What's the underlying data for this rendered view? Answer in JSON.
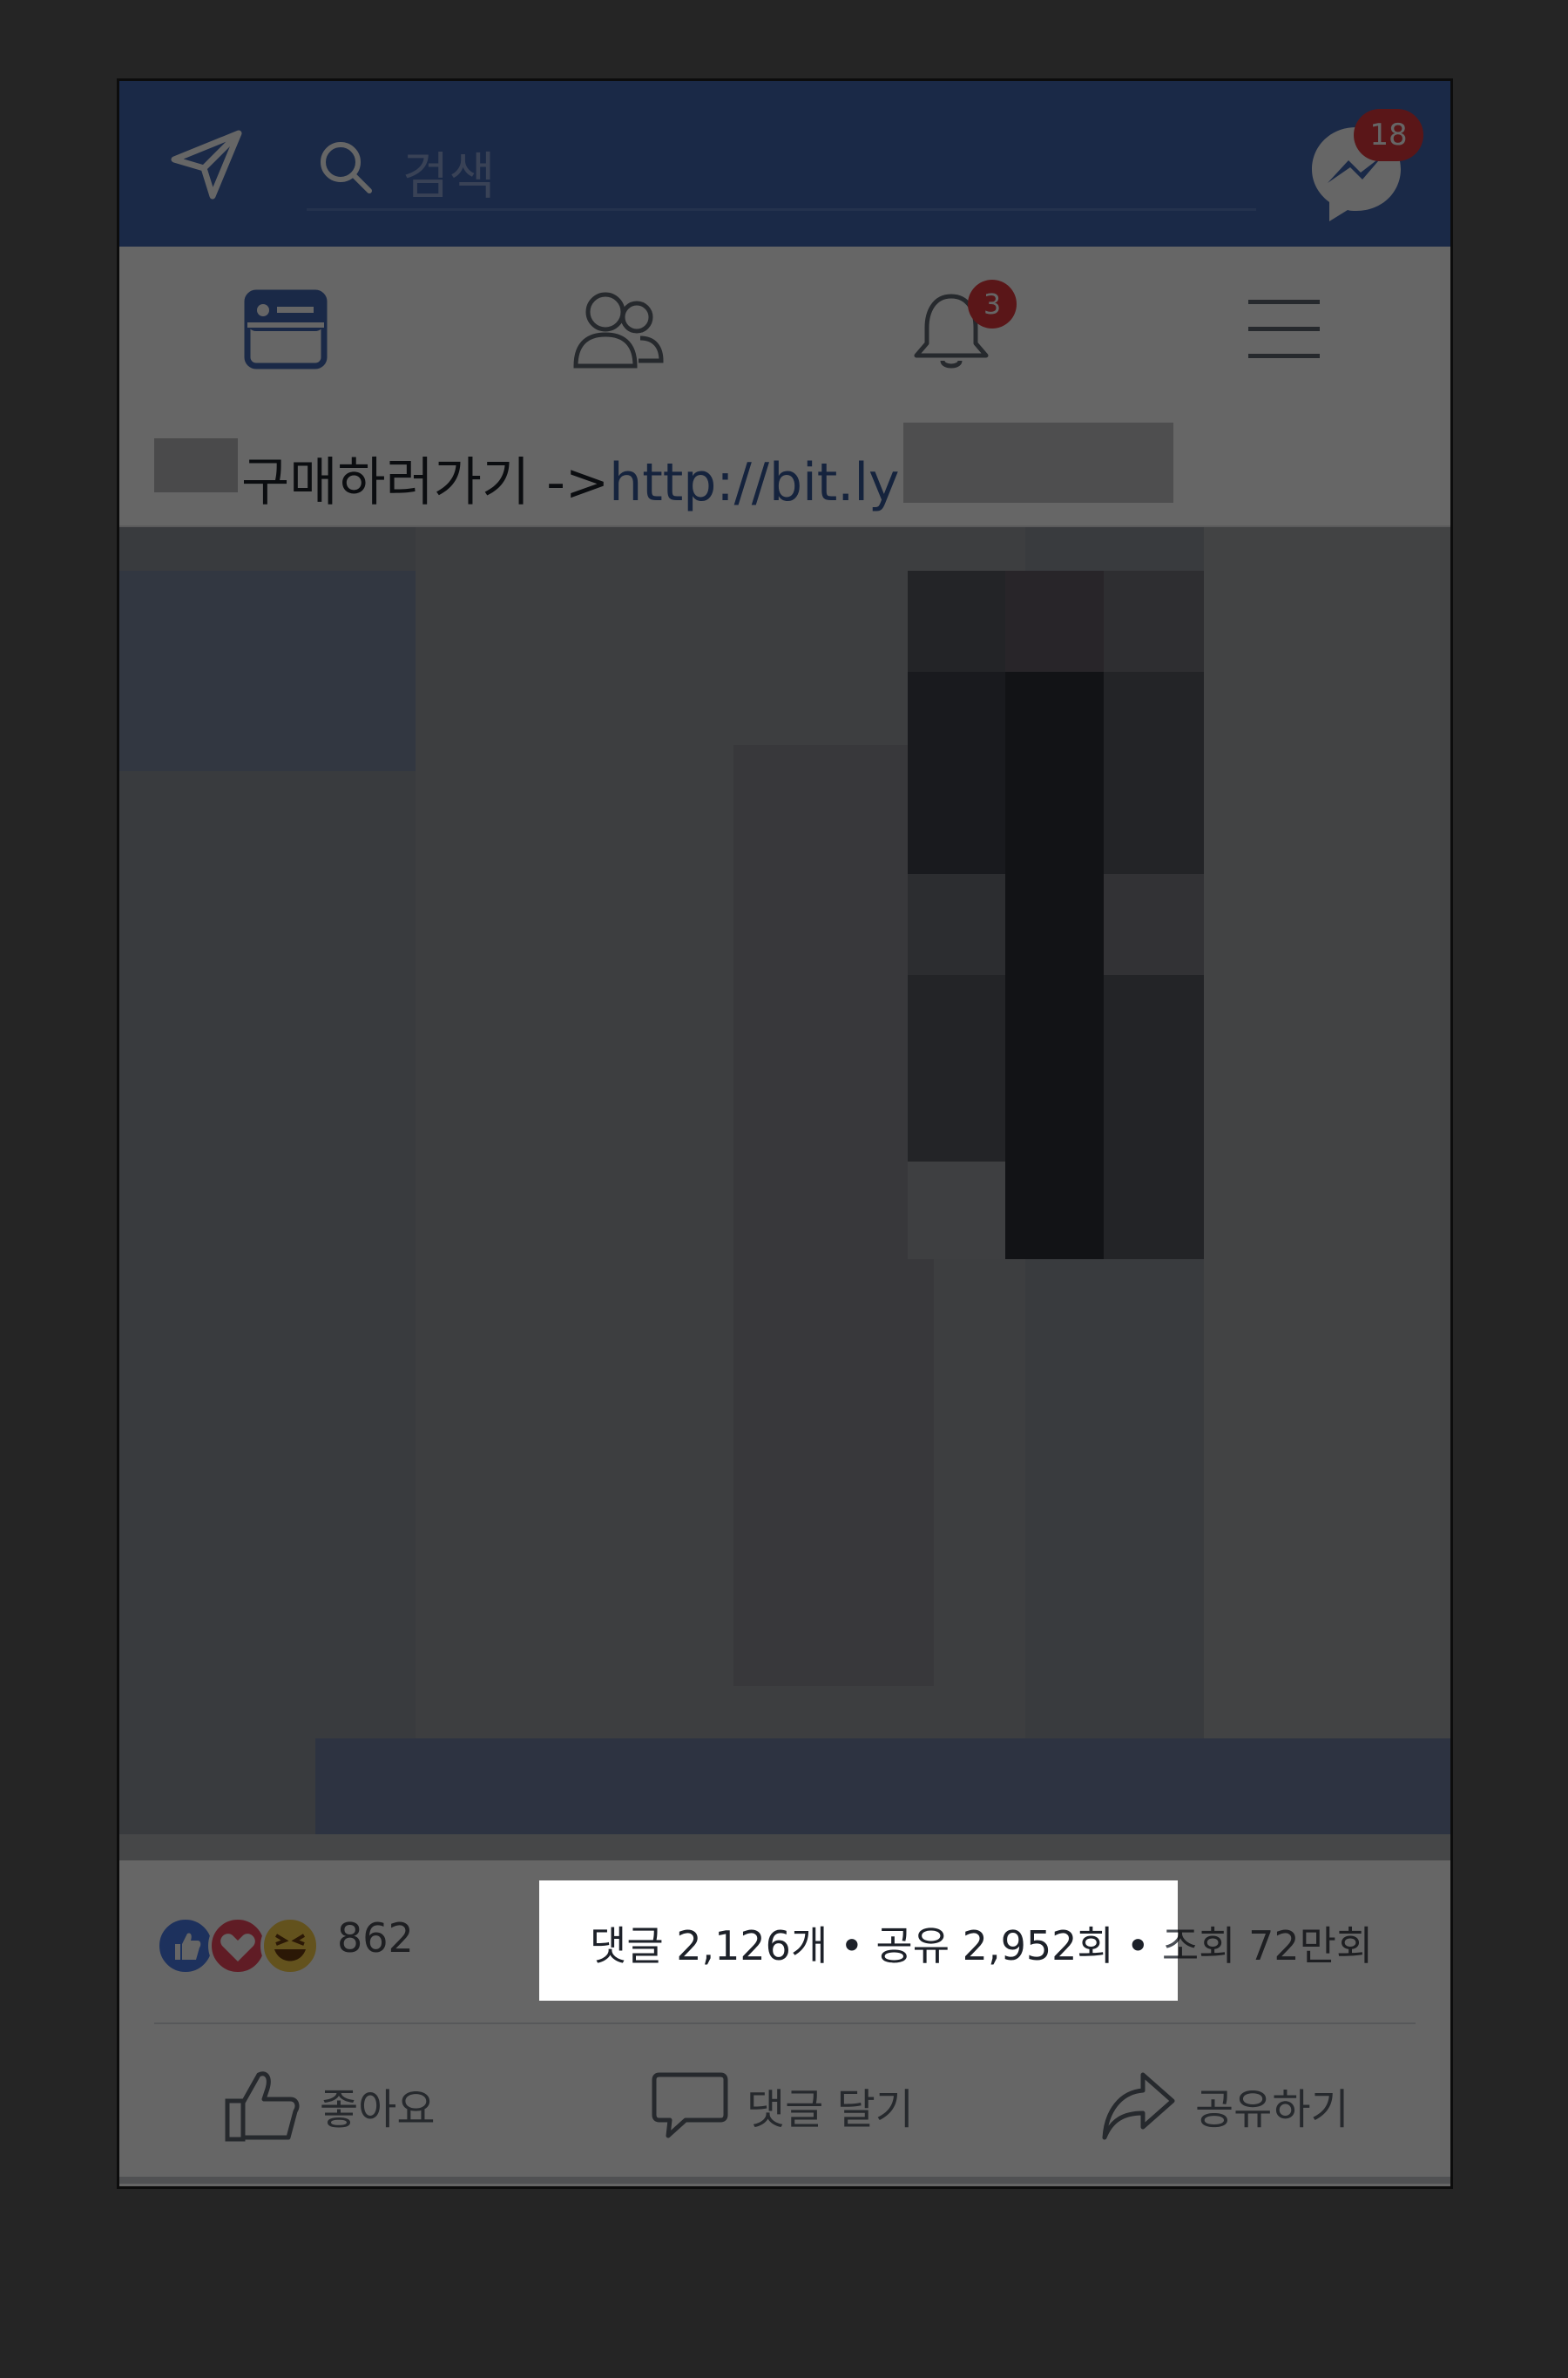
{
  "header": {
    "search_placeholder": "검색",
    "messenger_badge": "18"
  },
  "tabs": {
    "notifications_badge": "3"
  },
  "post": {
    "text_prefix": "구매하러가기 ->",
    "link_text": "http://bit.ly"
  },
  "reactions": {
    "count": "862"
  },
  "stats": {
    "comments": "댓글 2,126개",
    "shares": "공유 2,952회",
    "views": "조회 72만회",
    "separator": "•"
  },
  "actions": {
    "like": "좋아요",
    "comment": "댓글 달기",
    "share": "공유하기"
  },
  "colors": {
    "brand": "#4267b2",
    "badge": "#e0393e",
    "link": "#365899"
  }
}
